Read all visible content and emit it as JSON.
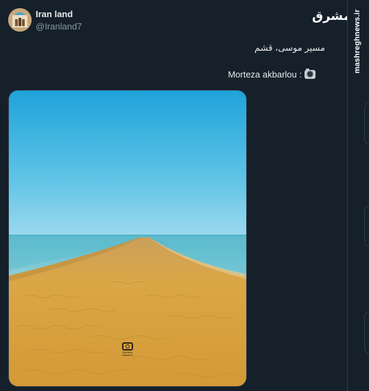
{
  "tweet": {
    "display_name": "Iran land",
    "handle": "@Iranland7",
    "text_line_1": "مسیر موسی، قشم",
    "text_line_2": "Morteza akbarlou :"
  },
  "photo": {
    "watermark_text": "Morteza Akbarlou",
    "description": ""
  },
  "brand": {
    "logo_text": "مشرق",
    "site_url": "mashreghnews.ir"
  },
  "colors": {
    "background": "#15202b",
    "text_primary": "#e7e9ea",
    "text_secondary": "#8b98a5",
    "sky_top": "#2aa9df",
    "sand": "#d6a03c"
  },
  "icons": {
    "avatar": "profile-avatar",
    "camera": "camera-emoji",
    "logo": "mashregh-logo"
  }
}
